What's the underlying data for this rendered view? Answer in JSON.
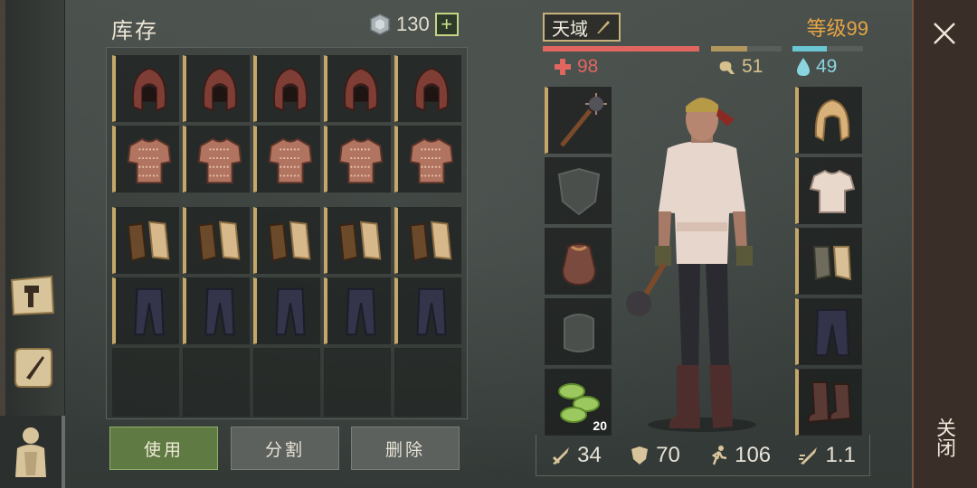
{
  "inventory": {
    "title": "库存",
    "currency": "130",
    "add_currency": "+",
    "rows": [
      {
        "item": "hood-icon",
        "count": 5
      },
      {
        "item": "chainmail-shirt-icon",
        "count": 5
      },
      {
        "item": "leather-gloves-icon",
        "count": 5
      },
      {
        "item": "dark-pants-icon",
        "count": 5
      },
      {
        "item": "empty",
        "count": 5
      }
    ]
  },
  "actions": {
    "use": "使用",
    "split": "分割",
    "delete": "删除"
  },
  "character": {
    "name": "天域",
    "level": "等级99",
    "health": "98",
    "food": "51",
    "water": "49",
    "health_fill": 1.0,
    "food_fill": 0.51,
    "water_fill": 0.49,
    "colors": {
      "health": "#e26660",
      "food": "#b1975e",
      "water": "#6bc6d4"
    },
    "left_slots": [
      {
        "icon": "spiked-mace-icon",
        "filled": true
      },
      {
        "icon": "shield-placeholder-icon",
        "filled": false
      },
      {
        "icon": "pouch-icon",
        "filled": false
      },
      {
        "icon": "backpack-placeholder-icon",
        "filled": false
      },
      {
        "icon": "food-rations-icon",
        "filled": false,
        "count": "20"
      }
    ],
    "right_slots": [
      {
        "icon": "hood-icon",
        "filled": true
      },
      {
        "icon": "linen-shirt-icon",
        "filled": true
      },
      {
        "icon": "gloves-icon",
        "filled": true
      },
      {
        "icon": "pants-icon",
        "filled": true
      },
      {
        "icon": "boots-icon",
        "filled": true
      }
    ]
  },
  "stats": {
    "attack": "34",
    "armor": "70",
    "speed": "106",
    "attack_speed": "1.1"
  },
  "close": {
    "label": "关闭"
  }
}
